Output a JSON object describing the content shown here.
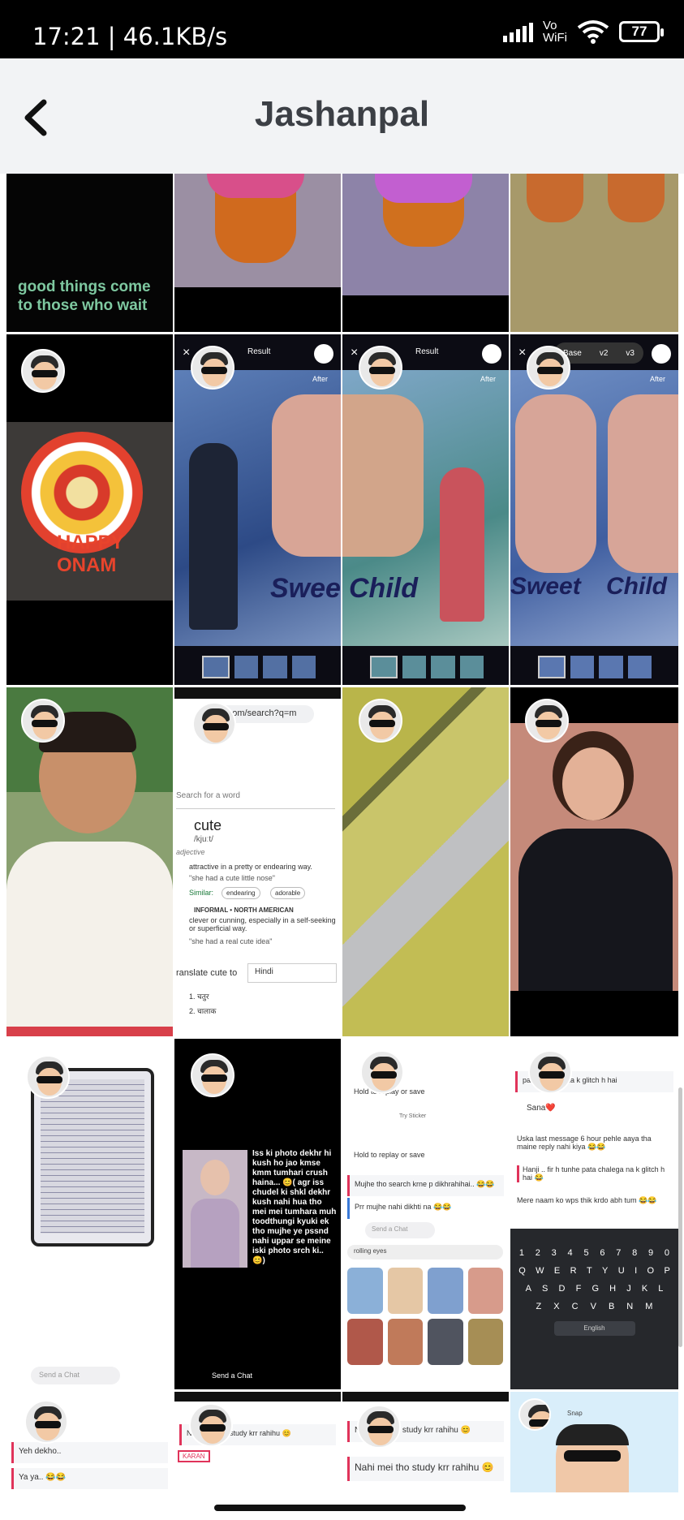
{
  "status": {
    "time": "17:21 | 46.1KB/s",
    "network": "Vo\nWiFi",
    "battery": "77"
  },
  "header": {
    "title": "Jashanpal"
  },
  "tiles": {
    "t1_text": "good things come to those who wait",
    "onam": "HAPPY ONAM",
    "result_label": "Result",
    "after_label": "After",
    "sweet": "Sweet",
    "child": "Child",
    "base": "Base",
    "v2": "v2",
    "v3": "v3",
    "dict_url": "y.com/search?q=m",
    "dict_search": "Search for a word",
    "dict_word": "cute",
    "dict_phonetic": "/kjuːt/",
    "dict_pos": "adjective",
    "dict_def1": "attractive in a pretty or endearing way.",
    "dict_ex1": "\"she had a cute little nose\"",
    "dict_similar": "Similar:",
    "dict_sim1": "endearing",
    "dict_sim2": "adorable",
    "dict_informal": "INFORMAL • NORTH AMERICAN",
    "dict_def2": "clever or cunning, especially in a self-seeking or superficial way.",
    "dict_ex2": "\"she had a real cute idea\"",
    "dict_translate": "ranslate cute to",
    "dict_lang": "Hindi",
    "dict_t1": "1. चतुर",
    "dict_t2": "2. चालाक",
    "chat_text_long": "Iss ki photo dekhr hi kush ho jao kmse kmm tumhari crush haina... 😊( agr iss chudel ki shkl dekhr kush nahi hua tho mei mei tumhara muh toodthungi kyuki ek tho mujhe ye pssnd nahi uppar se meine iski photo srch ki.. 😊)",
    "send_chat": "Send a Chat",
    "hold_replay": "Hold to replay or save",
    "try_sticker": "Try Sticker",
    "search_text": "Mujhe tho search krne p dikhrahihai.. 😂😂",
    "prr_text": "Prr mujhe nahi dikhti na 😂😂",
    "rolling": "rolling eyes",
    "glitch": "pata chalega na k glitch h hai",
    "sana": "Sana❤️",
    "uska": "Uska last message 6 hour pehle aaya tha maine reply nahi kiya 😂😂",
    "hanji": "Hanji .. fir h tunhe pata chalega na k glitch h hai 😂",
    "mere": "Mere naam ko wps thik krdo abh tum 😂😂",
    "english": "English",
    "yeh": "Yeh dekho..",
    "yaya": "Ya ya.. 😂😂",
    "nahi_study": "Nahi mei tho study krr rahihu 😊",
    "karan": "KARAN",
    "snap": "Snap"
  },
  "keyboard": {
    "row1": [
      "1",
      "2",
      "3",
      "4",
      "5",
      "6",
      "7",
      "8",
      "9",
      "0"
    ],
    "row2": [
      "Q",
      "W",
      "E",
      "R",
      "T",
      "Y",
      "U",
      "I",
      "O",
      "P"
    ],
    "row3": [
      "A",
      "S",
      "D",
      "F",
      "G",
      "H",
      "J",
      "K",
      "L"
    ],
    "row4": [
      "Z",
      "X",
      "C",
      "V",
      "B",
      "N",
      "M"
    ]
  }
}
